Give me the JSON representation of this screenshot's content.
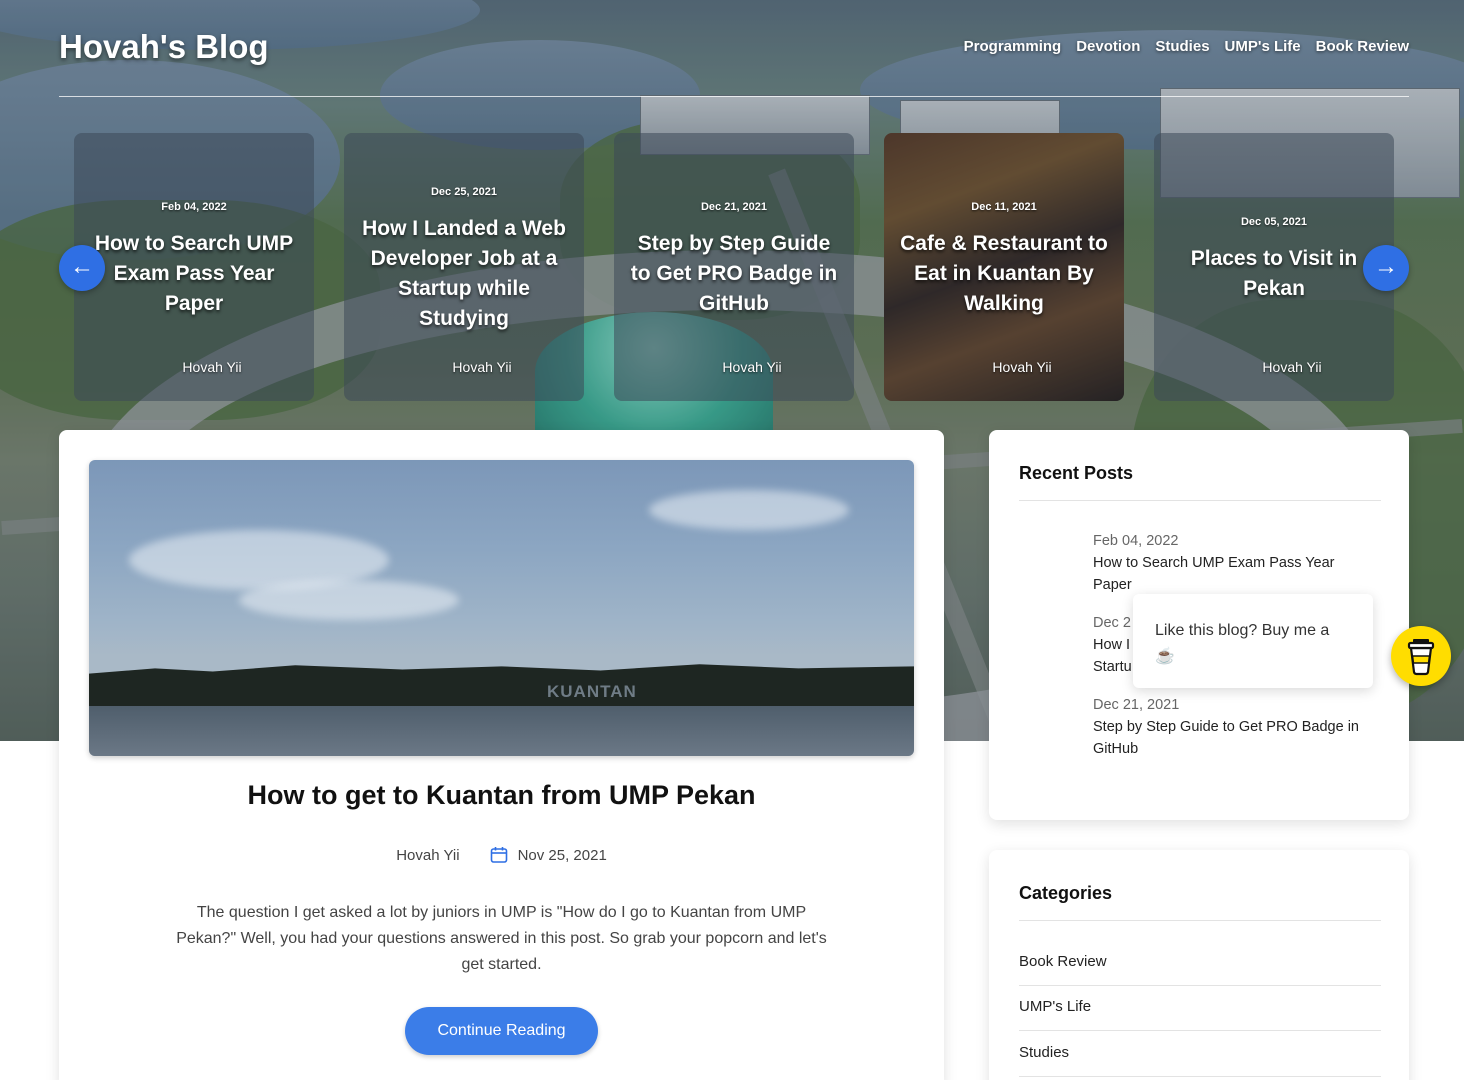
{
  "header": {
    "site_title": "Hovah's Blog",
    "nav": [
      "Programming",
      "Devotion",
      "Studies",
      "UMP's Life",
      "Book Review"
    ]
  },
  "carousel": {
    "cards": [
      {
        "date": "Feb 04, 2022",
        "title": "How to Search UMP Exam Pass Year Paper",
        "author": "Hovah Yii"
      },
      {
        "date": "Dec 25, 2021",
        "title": "How I Landed a Web Developer Job at a Startup while Studying",
        "author": "Hovah Yii"
      },
      {
        "date": "Dec 21, 2021",
        "title": "Step by Step Guide to Get PRO Badge in GitHub",
        "author": "Hovah Yii"
      },
      {
        "date": "Dec 11, 2021",
        "title": "Cafe & Restaurant to Eat in Kuantan By Walking",
        "author": "Hovah Yii"
      },
      {
        "date": "Dec 05, 2021",
        "title": "Places to Visit in Pekan",
        "author": "Hovah Yii"
      }
    ],
    "prev_icon": "arrow-left-icon",
    "next_icon": "arrow-right-icon"
  },
  "post": {
    "image_sign": "KUANTAN",
    "title": "How to get to Kuantan from UMP Pekan",
    "author": "Hovah Yii",
    "date": "Nov 25, 2021",
    "excerpt": "The question I get asked a lot by juniors in UMP is \"How do I go to Kuantan from UMP Pekan?\" Well, you had your questions answered in this post. So grab your popcorn and let's get started.",
    "cta": "Continue Reading"
  },
  "sidebar": {
    "recent_title": "Recent Posts",
    "recent": [
      {
        "date": "Feb 04, 2022",
        "title": "How to Search UMP Exam Pass Year Paper"
      },
      {
        "date": "Dec 2",
        "title": "How I"
      },
      {
        "date": "Dec 21, 2021",
        "title": "Step by Step Guide to Get PRO Badge in GitHub"
      }
    ],
    "recent_partial_line": "Startu",
    "categories_title": "Categories",
    "categories": [
      "Book Review",
      "UMP's Life",
      "Studies"
    ]
  },
  "bmc": {
    "popup_text": "Like this blog? Buy me a",
    "popup_emoji": "☕",
    "button_icon": "coffee-cup-icon",
    "button_color": "#ffdd00"
  },
  "colors": {
    "accent": "#3b7de8",
    "arrow": "#2f6fe4"
  }
}
